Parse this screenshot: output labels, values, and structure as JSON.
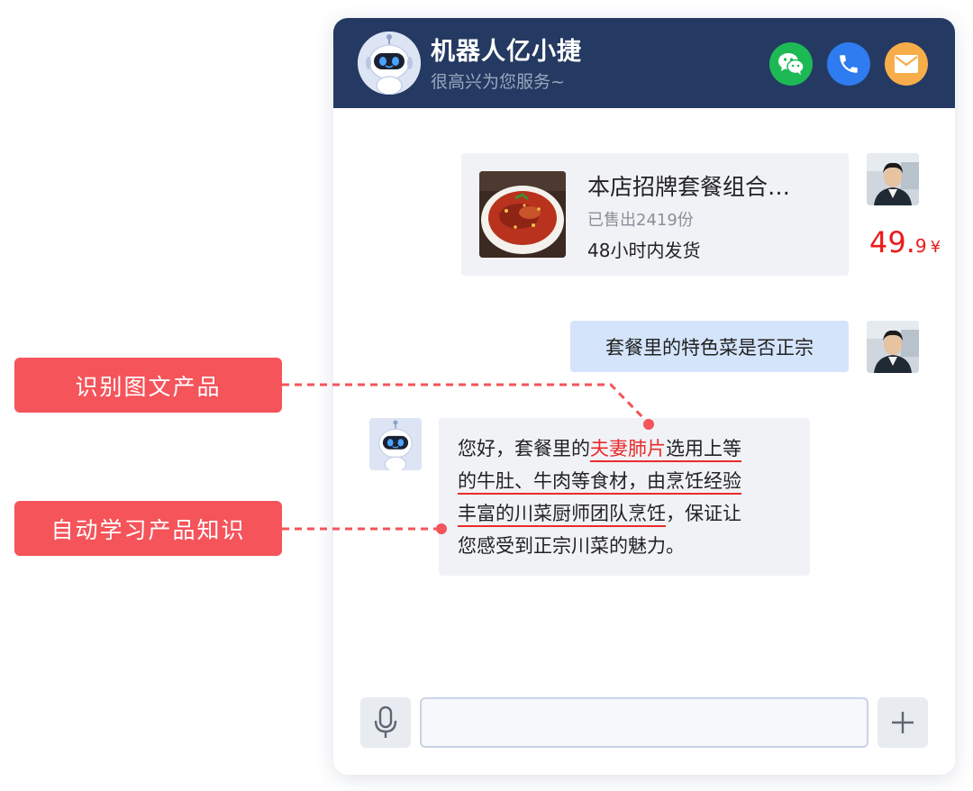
{
  "header": {
    "title": "机器人亿小捷",
    "subtitle": "很高兴为您服务~",
    "actions": [
      {
        "name": "wechat",
        "icon": "wechat-icon",
        "color": "#1db955"
      },
      {
        "name": "phone",
        "icon": "phone-icon",
        "color": "#2f7bf0"
      },
      {
        "name": "mail",
        "icon": "mail-icon",
        "color": "#f6ad4a"
      }
    ],
    "background": "#253a62"
  },
  "messages": {
    "product_card": {
      "title": "本店招牌套餐组合…",
      "sold": "已售出2419份",
      "shipping": "48小时内发货",
      "price_int": "49.",
      "price_dec": "9",
      "currency": "¥",
      "image_icon": "food-dish-image"
    },
    "user_question": "套餐里的特色菜是否正宗",
    "bot_reply": {
      "l1_a": "您好，套餐里的",
      "l1_highlight": "夫妻肺片",
      "l1_b": "选用上等",
      "l2": "的牛肚、牛肉等食材，由烹饪经验",
      "l3_a": "丰富的川菜厨师团队烹饪",
      "l3_b": "，保证让",
      "l4": "您感受到正宗川菜的魅力。"
    }
  },
  "input_bar": {
    "mic_icon": "microphone-icon",
    "placeholder": "",
    "value": "",
    "plus_icon": "plus-icon"
  },
  "annotations": [
    {
      "label": "识别图文产品"
    },
    {
      "label": "自动学习产品知识"
    }
  ],
  "colors": {
    "accent_red": "#ea2b2b",
    "annotation_red": "#f4545a",
    "user_bubble": "#d4e4fb",
    "bot_bubble": "#f0f2f6"
  }
}
